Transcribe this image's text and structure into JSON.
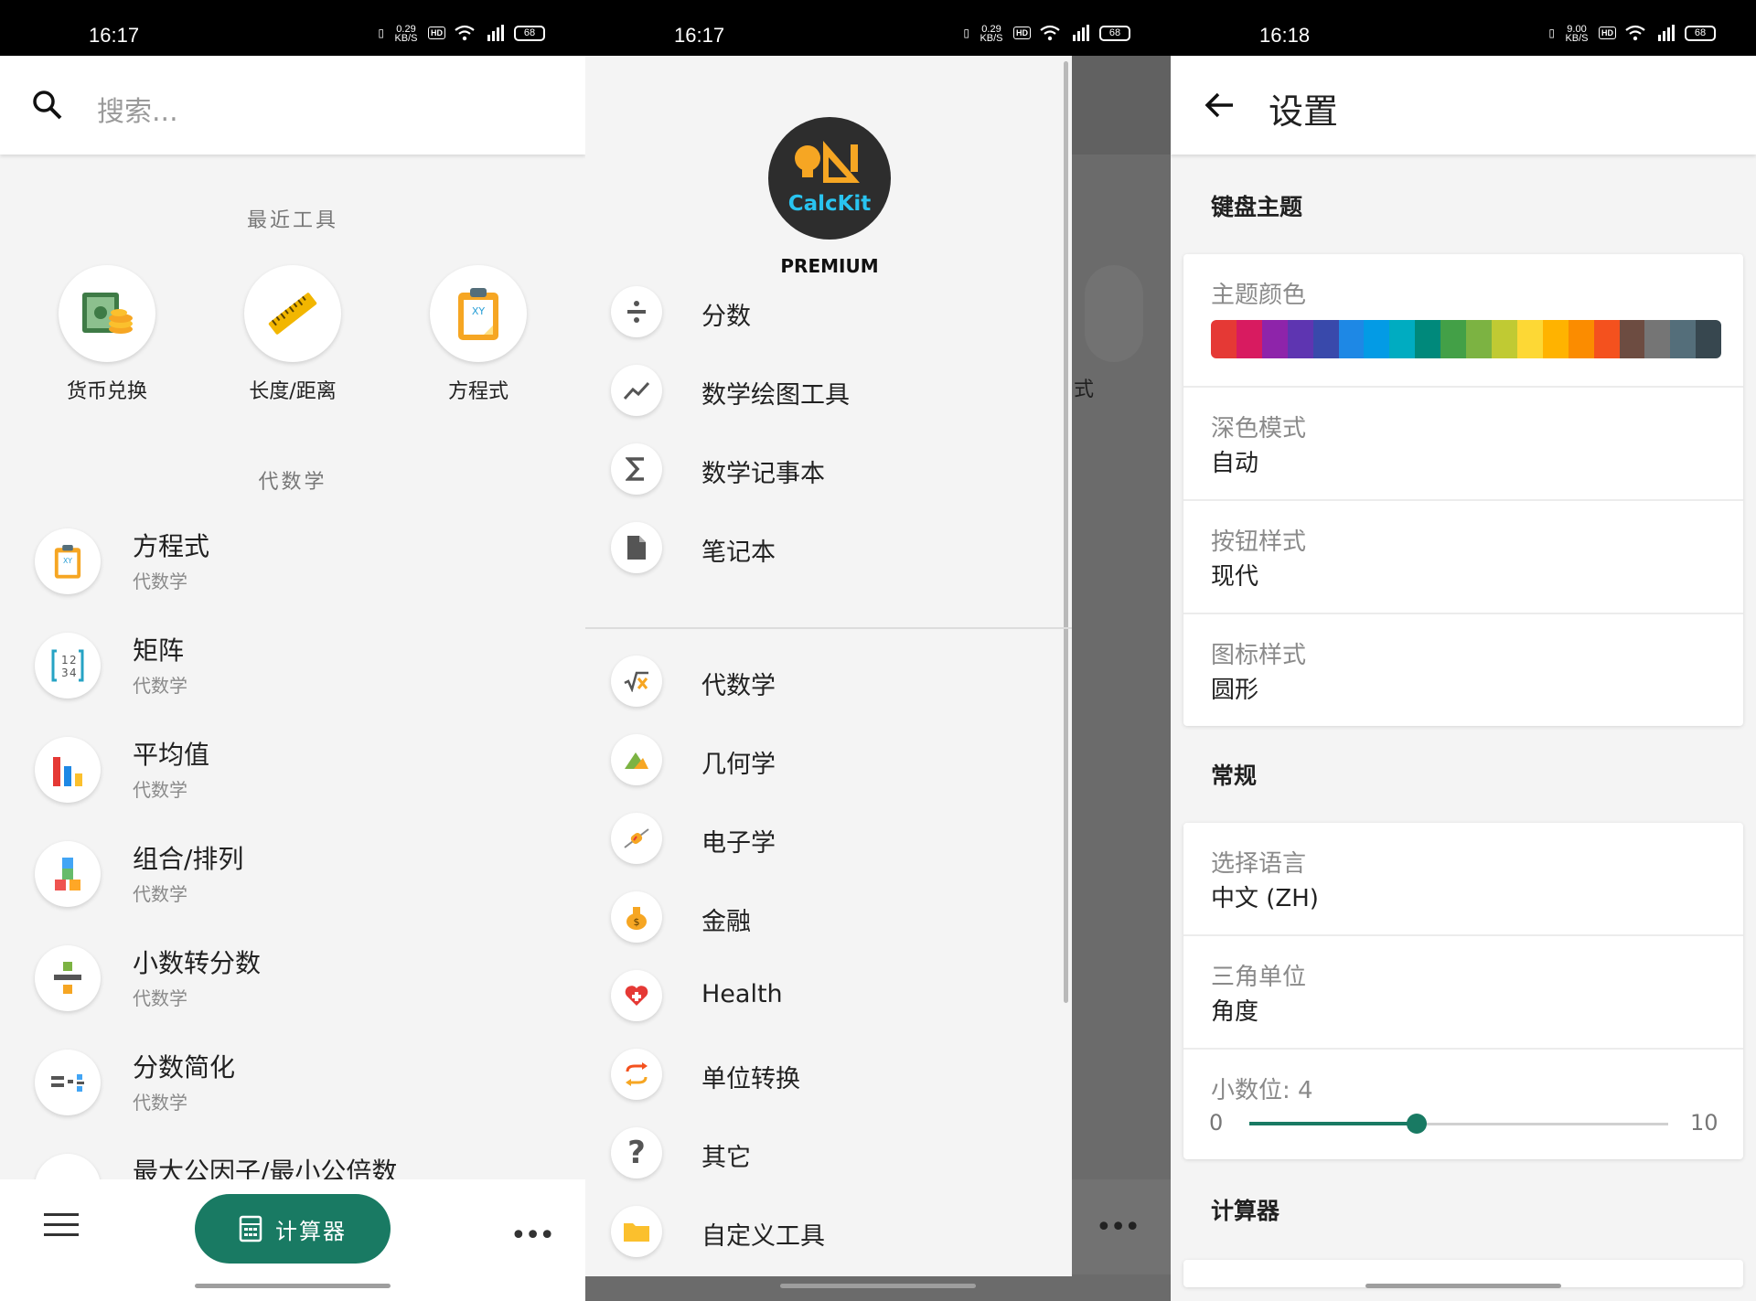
{
  "colors": {
    "accent": "#197a63",
    "status_bar": "#000000",
    "background": "#f4f4f4"
  },
  "panel1": {
    "status": {
      "time": "16:17",
      "speed": "0.29 KB/S",
      "hd": "HD",
      "net": "5G",
      "battery": "68"
    },
    "search": {
      "placeholder": "搜索..."
    },
    "recent_title": "最近工具",
    "recent": [
      {
        "label": "货币兑换",
        "icon": "currency-exchange-icon"
      },
      {
        "label": "长度/距离",
        "icon": "ruler-icon"
      },
      {
        "label": "方程式",
        "icon": "equation-clipboard-icon"
      }
    ],
    "algebra_title": "代数学",
    "items": [
      {
        "title": "方程式",
        "sub": "代数学",
        "icon": "equation-clipboard-icon"
      },
      {
        "title": "矩阵",
        "sub": "代数学",
        "icon": "matrix-icon"
      },
      {
        "title": "平均值",
        "sub": "代数学",
        "icon": "bar-chart-icon"
      },
      {
        "title": "组合/排列",
        "sub": "代数学",
        "icon": "blocks-icon"
      },
      {
        "title": "小数转分数",
        "sub": "代数学",
        "icon": "divide-icon"
      },
      {
        "title": "分数简化",
        "sub": "代数学",
        "icon": "fraction-simplify-icon"
      },
      {
        "title": "最大公因子/最小公倍数",
        "sub": "",
        "icon": "gcd-icon"
      }
    ],
    "calc_button": "计算器"
  },
  "panel2": {
    "status": {
      "time": "16:17",
      "speed": "0.29 KB/S",
      "hd": "HD",
      "net": "5G",
      "battery": "68"
    },
    "logo_text": "CalcKit",
    "premium": "PREMIUM",
    "items": [
      {
        "label": "分数",
        "icon": "divide-icon"
      },
      {
        "label": "数学绘图工具",
        "icon": "trend-line-icon"
      },
      {
        "label": "数学记事本",
        "icon": "sigma-icon"
      },
      {
        "label": "笔记本",
        "icon": "document-icon"
      },
      {
        "label": "代数学",
        "icon": "square-root-icon"
      },
      {
        "label": "几何学",
        "icon": "geometry-icon"
      },
      {
        "label": "电子学",
        "icon": "resistor-icon"
      },
      {
        "label": "金融",
        "icon": "money-bag-icon"
      },
      {
        "label": "Health",
        "icon": "heart-icon"
      },
      {
        "label": "单位转换",
        "icon": "convert-arrows-icon"
      },
      {
        "label": "其它",
        "icon": "question-icon"
      },
      {
        "label": "自定义工具",
        "icon": "folder-icon"
      }
    ],
    "ghost_label": "式"
  },
  "panel3": {
    "status": {
      "time": "16:18",
      "speed": "9.00 KB/S",
      "hd": "HD",
      "net": "5G",
      "battery": "68"
    },
    "title": "设置",
    "keyboard_theme_title": "键盘主题",
    "theme_color_label": "主题颜色",
    "theme_colors": [
      "#e53935",
      "#d81b60",
      "#8e24aa",
      "#5e35b1",
      "#3949ab",
      "#1e88e5",
      "#039be5",
      "#00acc1",
      "#00897b",
      "#43a047",
      "#7cb342",
      "#c0ca33",
      "#fdd835",
      "#ffb300",
      "#fb8c00",
      "#f4511e",
      "#6d4c41",
      "#757575",
      "#546e7a",
      "#37474f"
    ],
    "dark_mode": {
      "label": "深色模式",
      "value": "自动"
    },
    "button_style": {
      "label": "按钮样式",
      "value": "现代"
    },
    "icon_style": {
      "label": "图标样式",
      "value": "圆形"
    },
    "general_title": "常规",
    "language": {
      "label": "选择语言",
      "value": "中文 (ZH)"
    },
    "trig_unit": {
      "label": "三角单位",
      "value": "角度"
    },
    "decimals": {
      "label": "小数位: 4",
      "value": 4,
      "min": "0",
      "max": "10"
    },
    "calculator_title": "计算器"
  }
}
